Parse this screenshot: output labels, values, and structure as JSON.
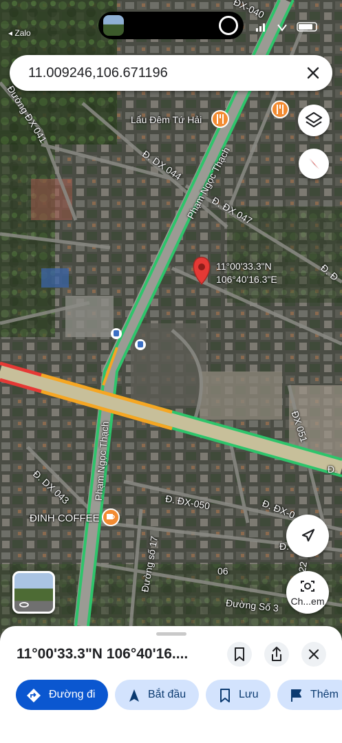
{
  "status_bar": {
    "back_label": "◂ Zalo"
  },
  "search": {
    "query": "11.009246,106.671196"
  },
  "map": {
    "pin": {
      "lat_label": "11°00'33.3\"N",
      "lng_label": "106°40'16.3\"E"
    },
    "places": [
      {
        "name": "Lẩu Đêm Tứ Hải",
        "category": "restaurant",
        "color": "#f28b32"
      },
      {
        "name": "ĐINH COFFEE",
        "category": "cafe",
        "color": "#f28b32"
      }
    ],
    "streets": {
      "main_road_upper": "Phạm Ngọc Thạch",
      "main_road_lower": "Phạm Ngọc Thạch",
      "dx041": "Đường ĐX 041",
      "dx044": "Đ. DX 044",
      "dx047": "Đ. ĐX 047",
      "dx043": "Đ. DX 043",
      "dx050": "Đ. ĐX-050",
      "dx051": "ĐX 051",
      "dx040": "ĐX-040",
      "so17": "Đường số 17",
      "so3": "Đường Số 3",
      "s06": "06",
      "s22": "22",
      "dx_edge": "Đ. ĐX-0",
      "d_right": "Đ. Đ",
      "d_mid": "Đ.",
      "d_far": "Đ."
    },
    "traffic_colors": {
      "green": "#2ec46b",
      "orange": "#f5a623",
      "red": "#e53935"
    }
  },
  "controls": {
    "lens_label": "Ch...em"
  },
  "sheet": {
    "title": "11°00'33.3\"N 106°40'16....",
    "actions": [
      {
        "label": "Đường đi",
        "icon": "directions-icon"
      },
      {
        "label": "Bắt đầu",
        "icon": "navigation-arrow-icon"
      },
      {
        "label": "Lưu",
        "icon": "bookmark-icon"
      },
      {
        "label": "Thêm",
        "icon": "flag-icon"
      }
    ]
  }
}
